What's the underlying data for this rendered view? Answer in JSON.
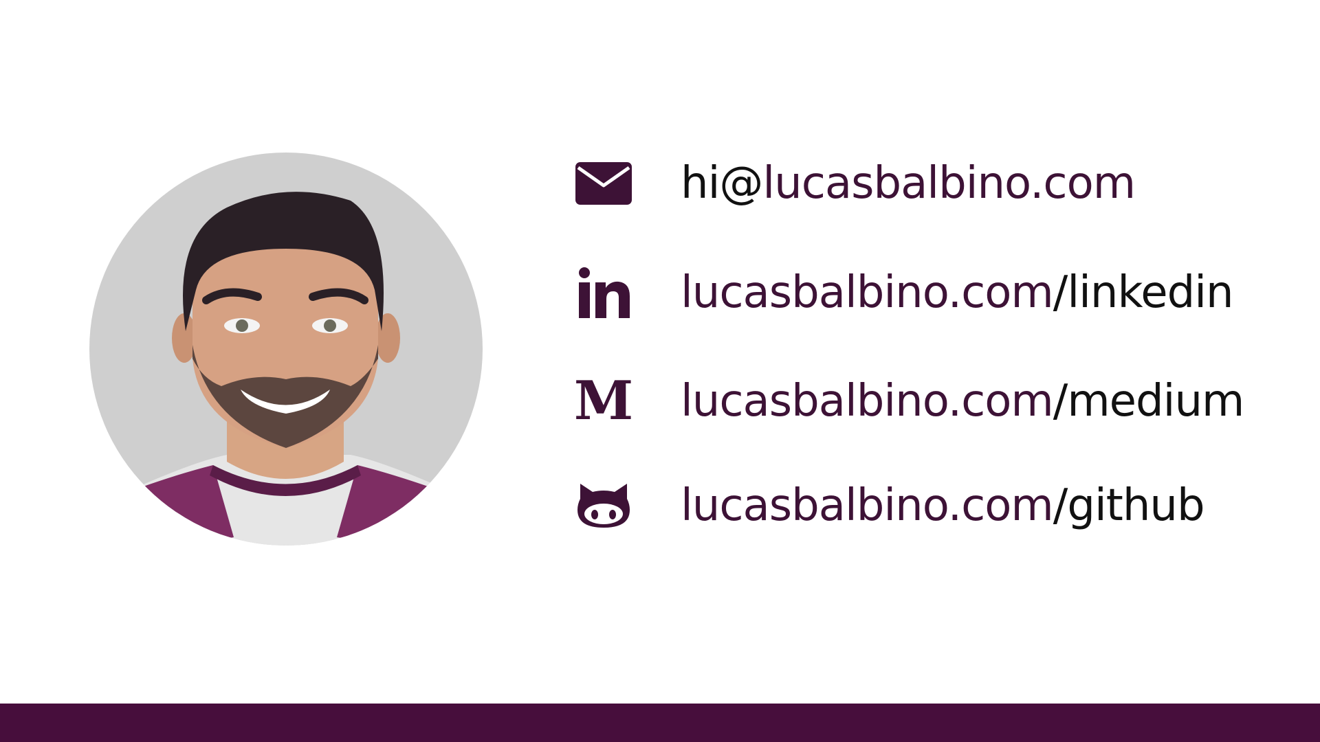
{
  "colors": {
    "accent": "#3d1236",
    "footer": "#470e3c",
    "text": "#111111",
    "avatar_bg": "#cfcfcf"
  },
  "contacts": [
    {
      "icon": "envelope-icon",
      "prefix": "hi@",
      "main": "lucasbalbino.com",
      "suffix": ""
    },
    {
      "icon": "linkedin-icon",
      "prefix": "",
      "main": "lucasbalbino.com",
      "suffix": "/linkedin"
    },
    {
      "icon": "medium-icon",
      "prefix": "",
      "main": "lucasbalbino.com",
      "suffix": "/medium"
    },
    {
      "icon": "github-icon",
      "prefix": "",
      "main": "lucasbalbino.com",
      "suffix": "/github"
    }
  ]
}
